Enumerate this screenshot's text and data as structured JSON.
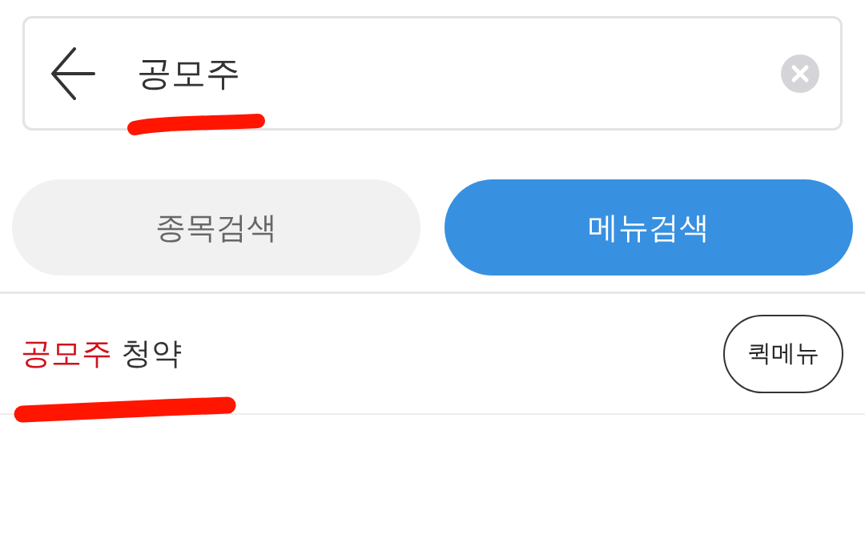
{
  "search": {
    "value": "공모주",
    "underlined": true
  },
  "tabs": [
    {
      "label": "종목검색",
      "selected": false
    },
    {
      "label": "메뉴검색",
      "selected": true
    }
  ],
  "results": [
    {
      "segments": [
        {
          "text": "공모주",
          "matched": true
        },
        {
          "text": "청약",
          "matched": false
        }
      ],
      "underlined": true,
      "button": "퀵메뉴"
    }
  ]
}
